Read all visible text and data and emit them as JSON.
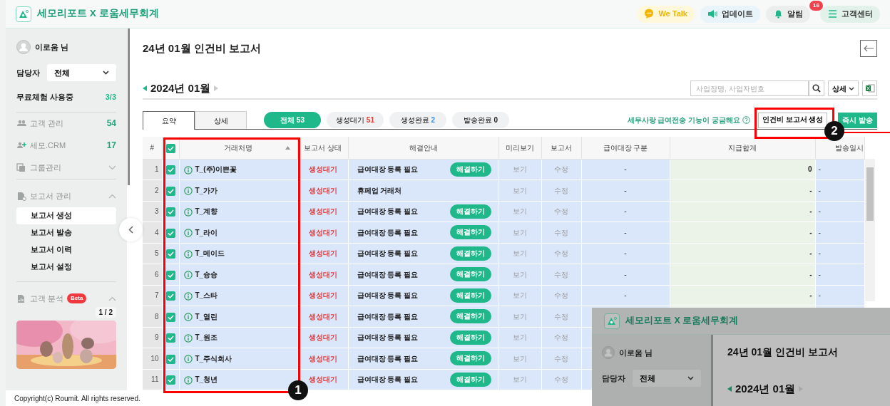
{
  "header": {
    "brand": "세모리포트 X 로움세무회계",
    "buttons": [
      {
        "kind": "talk",
        "label": "We Talk"
      },
      {
        "kind": "update",
        "label": "업데이트"
      },
      {
        "kind": "alarm",
        "label": "알림",
        "badge": "16"
      },
      {
        "kind": "help",
        "label": "고객센터"
      }
    ]
  },
  "sidebar": {
    "user": "이로움 님",
    "manager_label": "담당자",
    "manager_value": "전체",
    "trial_label": "무료체험 사용중",
    "trial_count": "3/3",
    "menu": [
      {
        "kind": "people",
        "label": "고객 관리",
        "count": "54"
      },
      {
        "kind": "crm",
        "label": "세모.CRM",
        "count": "17"
      },
      {
        "kind": "group",
        "label": "그룹관리",
        "expanded": false
      },
      {
        "kind": "report",
        "label": "보고서 관리",
        "expanded": true,
        "children": [
          {
            "label": "보고서 생성",
            "selected": true
          },
          {
            "label": "보고서 발송",
            "selected": false
          },
          {
            "label": "보고서 이력",
            "selected": false
          },
          {
            "label": "보고서 설정",
            "selected": false
          }
        ]
      },
      {
        "kind": "analysis",
        "label": "고객 분석",
        "badge": "Beta",
        "expanded": true
      }
    ],
    "pager": "1 / 2"
  },
  "page": {
    "title": "24년 01월 인건비 보고서",
    "month": "2024년 01월",
    "search_placeholder": "사업장명, 사업자번호",
    "detail_button": "상세",
    "view_tabs": [
      {
        "label": "요약",
        "selected": true
      },
      {
        "label": "상세",
        "selected": false
      }
    ],
    "filters": [
      {
        "label": "전체",
        "count": "53",
        "selected": true,
        "color": "#ffffff"
      },
      {
        "label": "생성대기",
        "count": "51",
        "selected": false,
        "color": "#e53935"
      },
      {
        "label": "생성완료",
        "count": "2",
        "selected": false,
        "color": "#3b8fe0"
      },
      {
        "label": "발송완료",
        "count": "0",
        "selected": false,
        "color": "#222222"
      }
    ],
    "help_text": "세무사랑 급여전송 기능이 궁금해요",
    "create_button": "인건비 보고서 생성",
    "send_button": "즉시 발송"
  },
  "table": {
    "columns": [
      "#",
      "거래처명",
      "보고서 상태",
      "해결안내",
      "미리보기",
      "보고서",
      "급여대장 구분",
      "지급합계",
      "발송일시"
    ],
    "all_checked": true,
    "rows": [
      {
        "num": "1",
        "checked": true,
        "name": "T_(주)이쁜꽃",
        "status": "생성대기",
        "guide": "급여대장 등록 필요",
        "resolve": "해결하기",
        "preview": "보기",
        "report": "수정",
        "category": "-",
        "total": "0",
        "sent": "-"
      },
      {
        "num": "2",
        "checked": true,
        "name": "T_가가",
        "status": "생성대기",
        "guide": "휴페업 거래처",
        "preview": "보기",
        "report": "수정",
        "category": "-",
        "total": "-",
        "sent": "-"
      },
      {
        "num": "3",
        "checked": true,
        "name": "T_계향",
        "status": "생성대기",
        "guide": "급여대장 등록 필요",
        "resolve": "해결하기",
        "preview": "보기",
        "report": "수정",
        "category": "-",
        "total": "-",
        "sent": "-"
      },
      {
        "num": "4",
        "checked": true,
        "name": "T_라이",
        "status": "생성대기",
        "guide": "급여대장 등록 필요",
        "resolve": "해결하기",
        "preview": "보기",
        "report": "수정",
        "category": "-",
        "total": "-",
        "sent": "-"
      },
      {
        "num": "5",
        "checked": true,
        "name": "T_메이드",
        "status": "생성대기",
        "guide": "급여대장 등록 필요",
        "resolve": "해결하기",
        "preview": "보기",
        "report": "수정",
        "category": "-",
        "total": "-",
        "sent": "-"
      },
      {
        "num": "6",
        "checked": true,
        "name": "T_슝슝",
        "status": "생성대기",
        "guide": "급여대장 등록 필요",
        "resolve": "해결하기",
        "preview": "보기",
        "report": "수정",
        "category": "-",
        "total": "-",
        "sent": "-"
      },
      {
        "num": "7",
        "checked": true,
        "name": "T_스타",
        "status": "생성대기",
        "guide": "급여대장 등록 필요",
        "resolve": "해결하기",
        "preview": "보기",
        "report": "수정",
        "category": "-",
        "total": "-",
        "sent": "-"
      },
      {
        "num": "8",
        "checked": true,
        "name": "T_열린",
        "status": "생성대기",
        "guide": "급여대장 등록 필요",
        "resolve": "해결하기",
        "preview": "보기",
        "report": "수정"
      },
      {
        "num": "9",
        "checked": true,
        "name": "T_원조",
        "status": "생성대기",
        "guide": "급여대장 등록 필요",
        "resolve": "해결하기",
        "preview": "보기",
        "report": "수정"
      },
      {
        "num": "10",
        "checked": true,
        "name": "T_주식회사",
        "status": "생성대기",
        "guide": "급여대장 등록 필요",
        "resolve": "해결하기",
        "preview": "보기",
        "report": "수정"
      },
      {
        "num": "11",
        "checked": true,
        "name": "T_청년",
        "status": "생성대기",
        "guide": "급여대장 등록 필요",
        "resolve": "해결하기",
        "preview": "보기",
        "report": "수정"
      }
    ]
  },
  "footer": "Copyright(c) Roumit. All rights reserved.",
  "annotations": [
    {
      "label": "1"
    },
    {
      "label": "2"
    }
  ],
  "inset_screenshot": {
    "brand": "세모리포트 X 로움세무회계",
    "user": "이로움 님",
    "manager_label": "담당자",
    "manager_value": "전체",
    "title": "24년 01월 인건비 보고서",
    "month": "2024년 01월"
  }
}
